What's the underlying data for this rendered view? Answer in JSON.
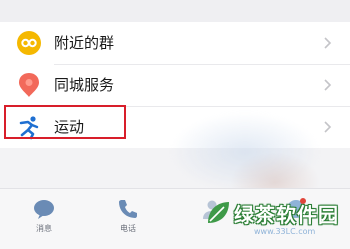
{
  "menu": {
    "items": [
      {
        "label": "附近的群",
        "icon": "group-icon"
      },
      {
        "label": "同城服务",
        "icon": "pin-icon"
      },
      {
        "label": "运动",
        "icon": "running-icon"
      }
    ]
  },
  "tabbar": {
    "tabs": [
      {
        "label": "消息",
        "icon": "message-bubble-icon"
      },
      {
        "label": "电话",
        "icon": "phone-icon"
      },
      {
        "label": "",
        "icon": "contacts-icon"
      },
      {
        "label": "",
        "icon": "discover-icon"
      }
    ]
  },
  "watermark": {
    "text": "绿茶软件园",
    "url": "www.33LC.com"
  },
  "colors": {
    "highlight": "#d81e2a",
    "group_icon": "#f5b800",
    "pin_icon": "#f2695a",
    "running_icon": "#1f6fd1",
    "tab_icon": "#6a8bb5"
  }
}
